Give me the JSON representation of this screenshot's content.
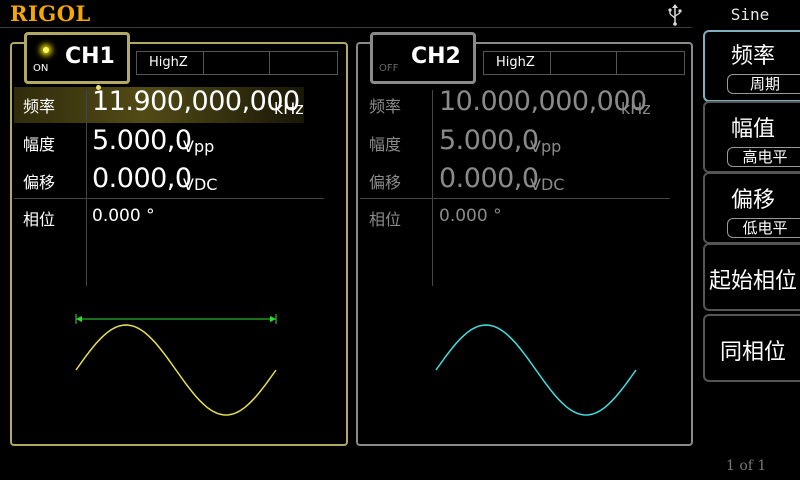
{
  "brand": "RIGOL",
  "menu": {
    "title": "Sine",
    "frequency": "频率",
    "period": "周期",
    "amplitude": "幅值",
    "high_level": "高电平",
    "offset": "偏移",
    "low_level": "低电平",
    "start_phase": "起始相位",
    "align_phase": "同相位",
    "page": "1 of 1"
  },
  "ch1": {
    "name": "CH1",
    "state": "ON",
    "load": "HighZ",
    "freq_label": "频率",
    "freq_value": "11.900,000,000",
    "freq_unit": "kHz",
    "amp_label": "幅度",
    "amp_value": "5.000,0",
    "amp_unit": "Vpp",
    "offset_label": "偏移",
    "offset_value": "0.000,0",
    "offset_unit": "VDC",
    "phase_label": "相位",
    "phase_value": "0.000 °",
    "wave_color": "#e8e050"
  },
  "ch2": {
    "name": "CH2",
    "state": "OFF",
    "load": "HighZ",
    "freq_label": "频率",
    "freq_value": "10.000,000,000",
    "freq_unit": "kHz",
    "amp_label": "幅度",
    "amp_value": "5.000,0",
    "amp_unit": "Vpp",
    "offset_label": "偏移",
    "offset_value": "0.000,0",
    "offset_unit": "VDC",
    "phase_label": "相位",
    "phase_value": "0.000 °",
    "wave_color": "#40e0e0"
  },
  "colors": {
    "brand": "#f5a800",
    "ch1_border": "#b2a962",
    "ch2_border": "#8a8a8a",
    "active_menu_border": "#7fb0bd"
  }
}
